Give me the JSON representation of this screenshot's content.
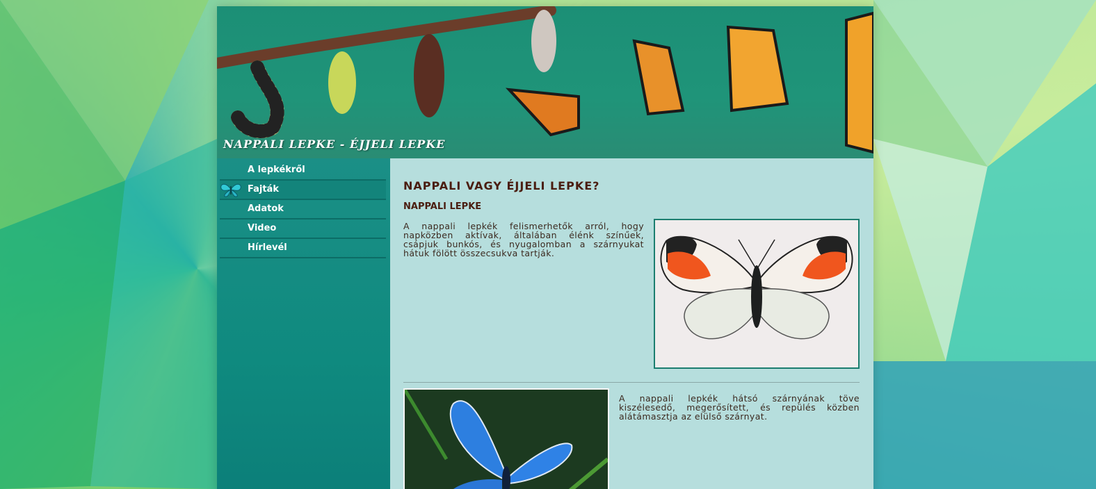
{
  "site": {
    "banner_title": "NAPPALI LEPKE - ÉJJELI LEPKE"
  },
  "nav": {
    "items": [
      {
        "label": "A lepkékről",
        "active": false
      },
      {
        "label": "Fajták",
        "active": true
      },
      {
        "label": "Adatok",
        "active": false
      },
      {
        "label": "Video",
        "active": false
      },
      {
        "label": "Hírlevél",
        "active": false
      }
    ]
  },
  "content": {
    "title": "NAPPALI VAGY ÉJJELI LEPKE?",
    "subtitle": "NAPPALI LEPKE",
    "paragraph1": "A nappali lepkék felismerhetők arról, hogy napközben aktívak, általában élénk színűek, csápjuk bunkós, és nyugalomban a szárnyukat hátuk fölött összecsukva tartják.",
    "paragraph2": "A nappali lepkék hátsó szárnyának töve kiszélesedő, megerősített, és repülés közben alátámasztja az elülső szárnyat."
  },
  "colors": {
    "heading": "#4a1d10",
    "sidebar": "#0f8a7f",
    "content_bg": "#b6dedd",
    "photo_border": "#1b7e6f"
  }
}
